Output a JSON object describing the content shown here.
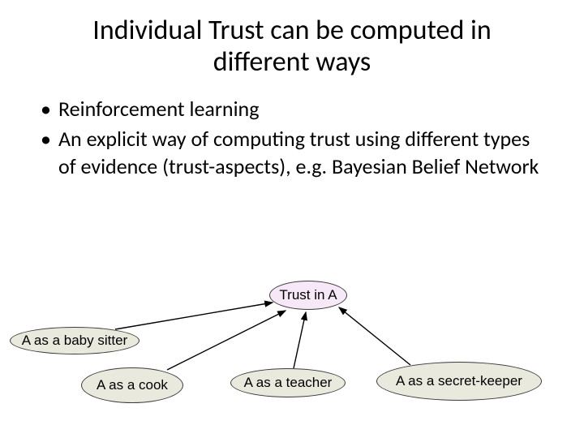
{
  "title": "Individual Trust can be computed in different ways",
  "bullets": [
    "Reinforcement learning",
    "An explicit way of computing trust using different types of evidence (trust-aspects), e.g. Bayesian Belief Network"
  ],
  "diagram": {
    "root": "Trust in A",
    "children": [
      "A as a baby sitter",
      "A as a cook",
      "A as a teacher",
      "A as a secret-keeper"
    ]
  }
}
